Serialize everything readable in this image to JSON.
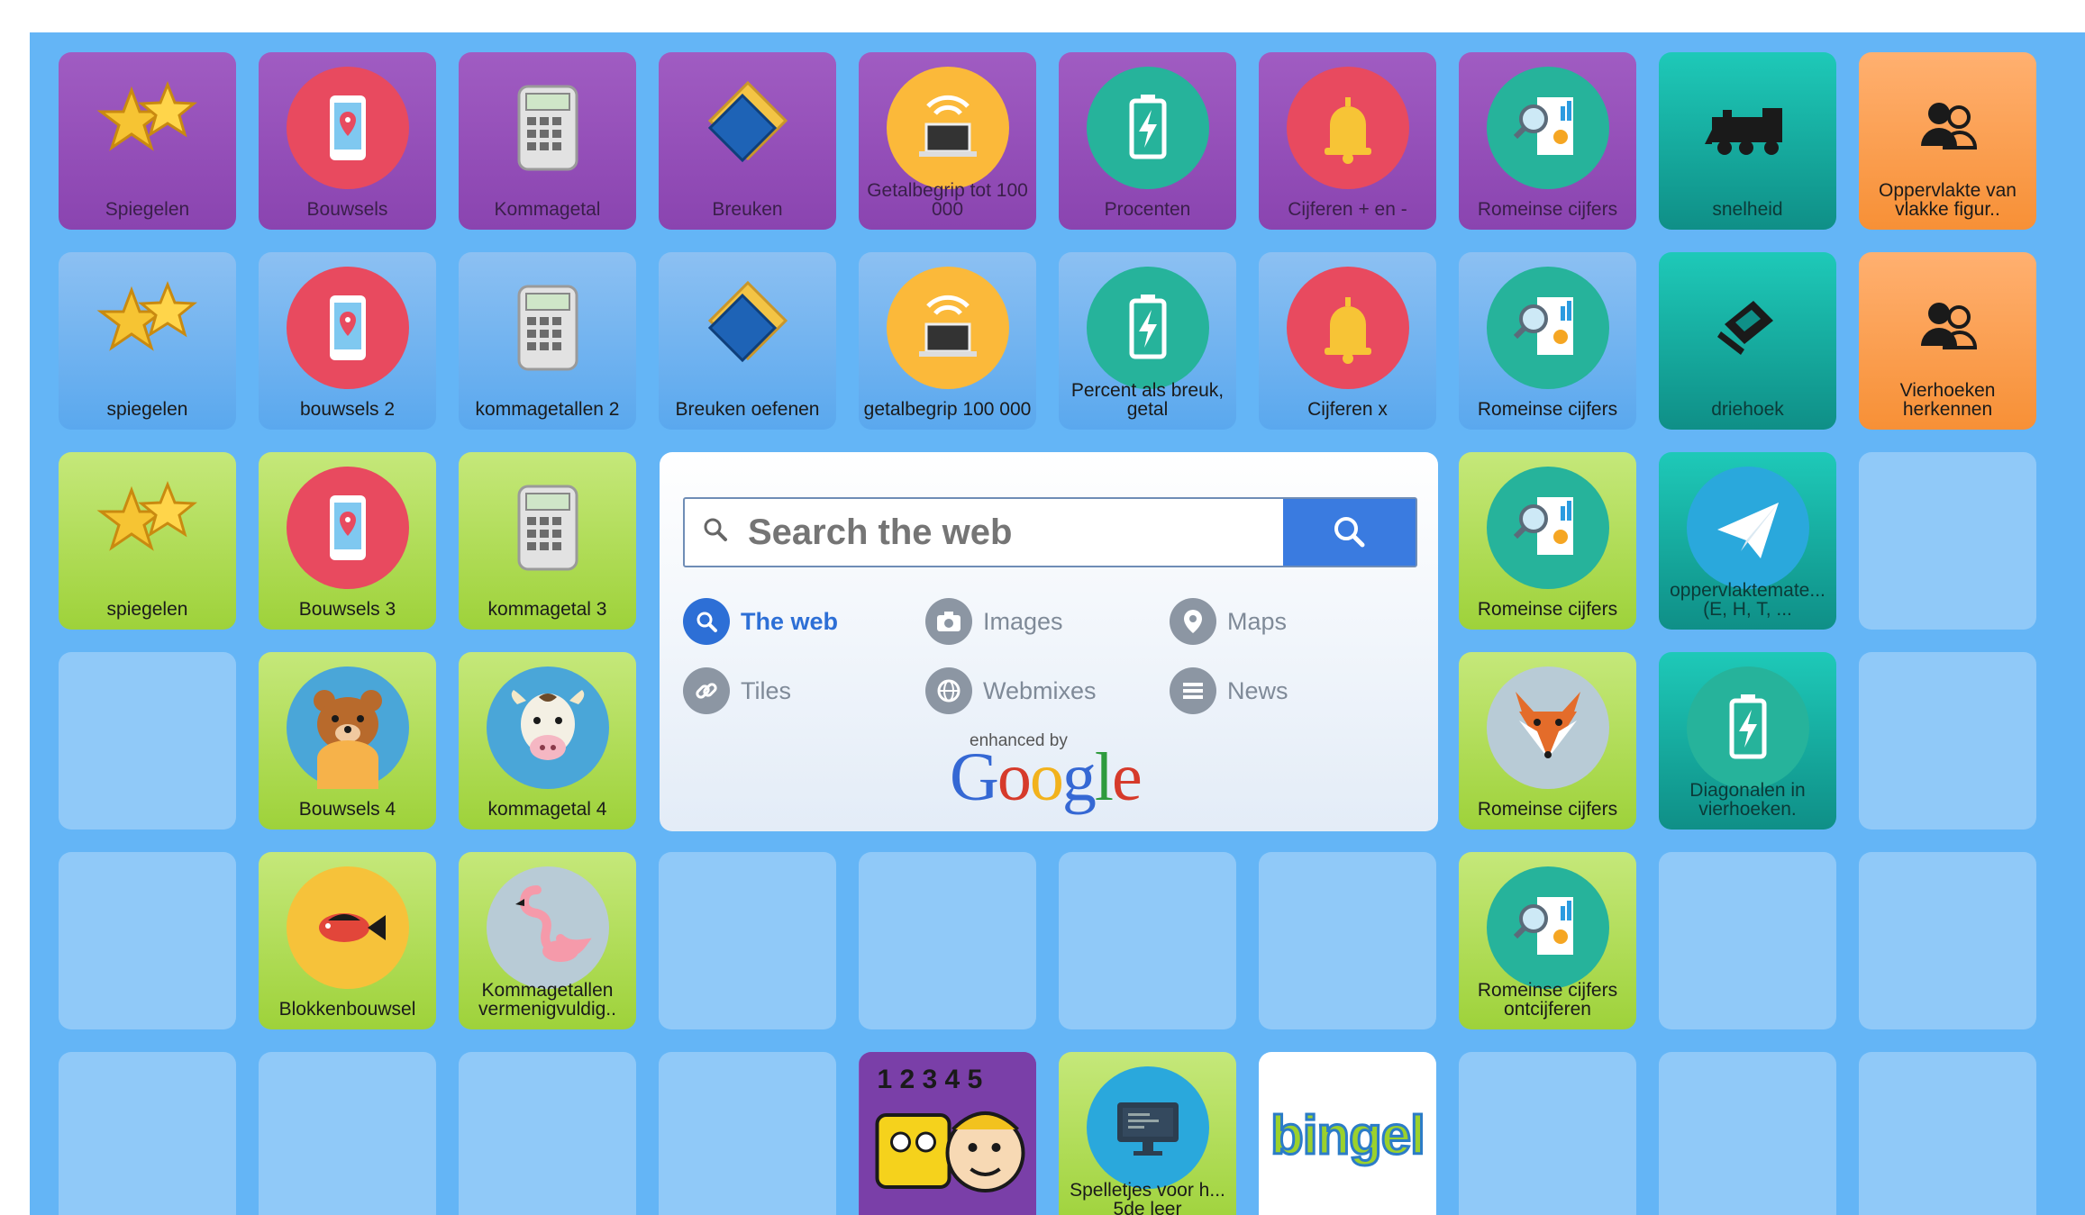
{
  "tiles_row1": [
    {
      "label": "Spiegelen",
      "icon": "stars-icon"
    },
    {
      "label": "Bouwsels",
      "icon": "phone-map-icon"
    },
    {
      "label": "Kommagetal",
      "icon": "calculator-icon"
    },
    {
      "label": "Breuken",
      "icon": "cards-icon"
    },
    {
      "label": "Getalbegrip tot 100 000",
      "icon": "laptop-wifi-icon"
    },
    {
      "label": "Procenten",
      "icon": "battery-icon"
    },
    {
      "label": "Cijferen + en -",
      "icon": "bell-icon"
    },
    {
      "label": "Romeinse cijfers",
      "icon": "report-icon"
    },
    {
      "label": "snelheid",
      "icon": "train-icon"
    },
    {
      "label": "Oppervlakte van vlakke figur..",
      "icon": "users-icon"
    }
  ],
  "tiles_row2": [
    {
      "label": "spiegelen",
      "icon": "stars-icon"
    },
    {
      "label": "bouwsels 2",
      "icon": "phone-map-icon"
    },
    {
      "label": "kommagetallen 2",
      "icon": "calculator-icon"
    },
    {
      "label": "Breuken oefenen",
      "icon": "cards-icon"
    },
    {
      "label": "getalbegrip 100 000",
      "icon": "laptop-wifi-icon"
    },
    {
      "label": "Percent als breuk, getal",
      "icon": "battery-icon"
    },
    {
      "label": "Cijferen x",
      "icon": "bell-icon"
    },
    {
      "label": "Romeinse cijfers",
      "icon": "report-icon"
    },
    {
      "label": "driehoek",
      "icon": "laptop-tilted-icon"
    },
    {
      "label": "Vierhoeken herkennen",
      "icon": "users-icon"
    }
  ],
  "tiles_row3": [
    {
      "label": "spiegelen",
      "icon": "stars-icon"
    },
    {
      "label": "Bouwsels 3",
      "icon": "phone-map-icon"
    },
    {
      "label": "kommagetal 3",
      "icon": "calculator-icon"
    },
    {
      "label": "Romeinse cijfers",
      "icon": "report-icon"
    },
    {
      "label": "oppervlaktemate... (E, H, T, ...",
      "icon": "paper-plane-icon"
    }
  ],
  "tiles_row4": [
    {
      "label": "Bouwsels 4",
      "icon": "bear-icon"
    },
    {
      "label": "kommagetal 4",
      "icon": "cow-icon"
    },
    {
      "label": "Romeinse cijfers",
      "icon": "fox-icon"
    },
    {
      "label": "Diagonalen in vierhoeken.",
      "icon": "battery-icon"
    }
  ],
  "tiles_row5": [
    {
      "label": "Blokkenbouwsel",
      "icon": "fish-icon"
    },
    {
      "label": "Kommagetallen vermenigvuldig..",
      "icon": "flamingo-icon"
    },
    {
      "label": "Romeinse cijfers ontcijferen",
      "icon": "report-icon"
    }
  ],
  "tiles_row6": [
    {
      "label": "",
      "icon": "cartoon-numbers-icon"
    },
    {
      "label": "Spelletjes voor h... 5de leer",
      "icon": "monitor-icon"
    },
    {
      "label": "",
      "icon": "bingel-logo"
    }
  ],
  "bingel_logo_text": "bingel",
  "search": {
    "placeholder": "Search the web",
    "options": [
      "The web",
      "Images",
      "Maps",
      "Tiles",
      "Webmixes",
      "News"
    ],
    "enhanced_by": "enhanced by",
    "brand": "Google"
  },
  "colors": {
    "board": "#64b5f6",
    "empty_tile": "#90c9f8",
    "purple": "#8a44b0",
    "blue": "#5aa8ee",
    "green": "#9ed23a",
    "teal": "#0f8f87",
    "orange": "#f79036",
    "search_button": "#3a7be0"
  }
}
